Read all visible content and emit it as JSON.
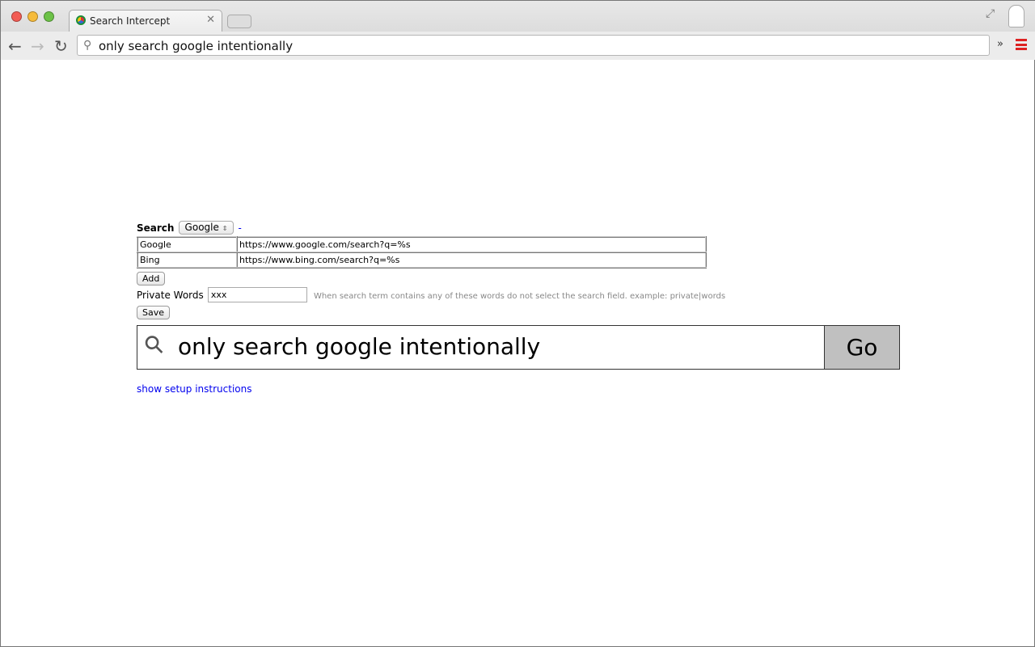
{
  "browser": {
    "tab_title": "Search Intercept",
    "address": "only search google intentionally"
  },
  "form": {
    "search_label": "Search",
    "engine_selected": "Google",
    "remove_label": "-",
    "engines": [
      {
        "name": "Google",
        "url": "https://www.google.com/search?q=%s"
      },
      {
        "name": "Bing",
        "url": "https://www.bing.com/search?q=%s"
      }
    ],
    "add_label": "Add",
    "private_words_label": "Private Words",
    "private_words_value": "xxx",
    "private_words_hint": "When search term contains any of these words do not select the search field. example: private|words",
    "save_label": "Save"
  },
  "search": {
    "query": "only search google intentionally",
    "go_label": "Go"
  },
  "setup_link": "show setup instructions"
}
